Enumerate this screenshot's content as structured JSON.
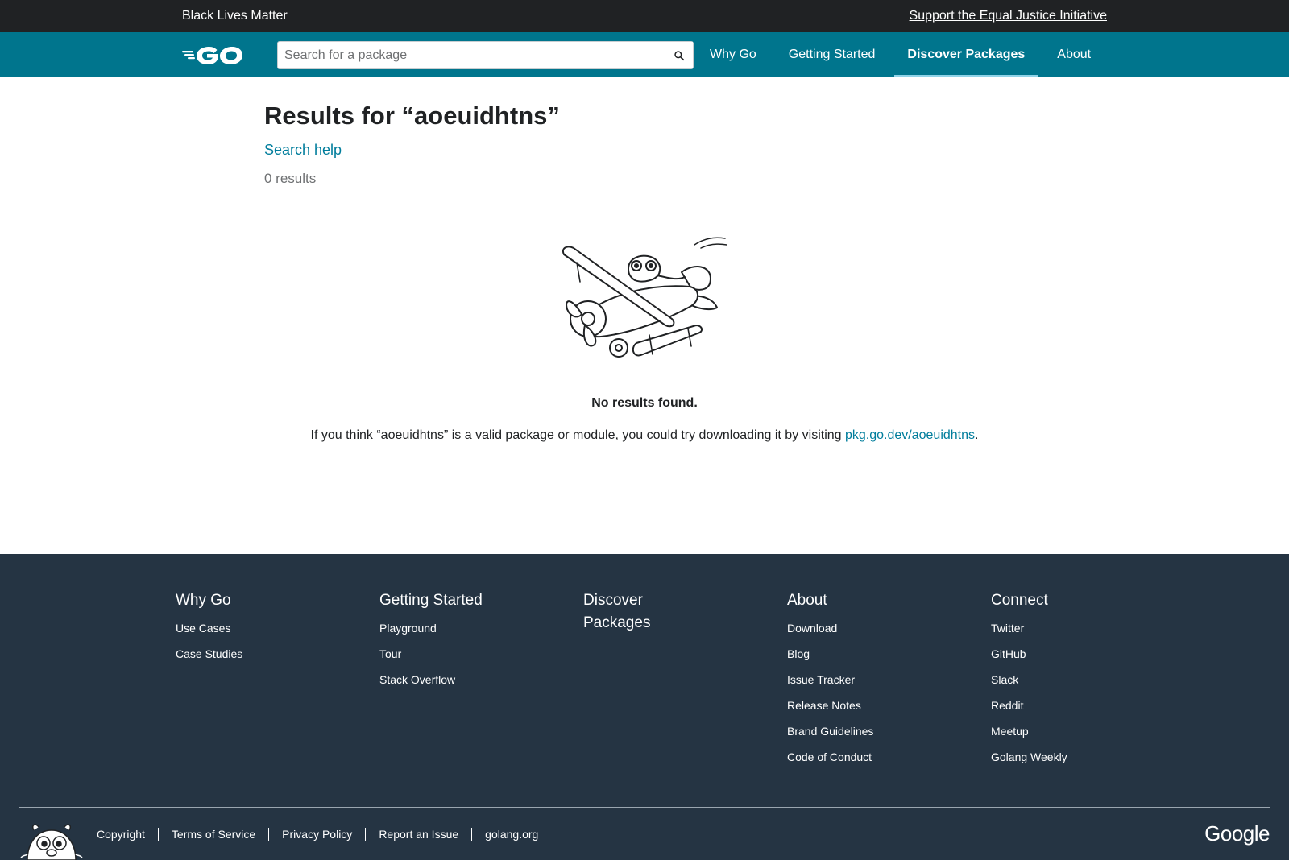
{
  "banner": {
    "blm_text": "Black Lives Matter",
    "eji_link": "Support the Equal Justice Initiative"
  },
  "header": {
    "logo_alt": "GO",
    "search": {
      "placeholder": "Search for a package",
      "value": ""
    },
    "nav": [
      {
        "label": "Why Go",
        "active": false
      },
      {
        "label": "Getting Started",
        "active": false
      },
      {
        "label": "Discover Packages",
        "active": true
      },
      {
        "label": "About",
        "active": false
      }
    ]
  },
  "main": {
    "title": "Results for “aoeuidhtns”",
    "search_help": "Search help",
    "results_count": "0 results",
    "no_results": "No results found.",
    "suggest_prefix": "If you think “aoeuidhtns” is a valid package or module, you could try downloading it by visiting ",
    "suggest_link": "pkg.go.dev/aoeuidhtns",
    "suggest_suffix": "."
  },
  "footer": {
    "columns": [
      {
        "heading": "Why Go",
        "links": [
          "Use Cases",
          "Case Studies"
        ]
      },
      {
        "heading": "Getting Started",
        "links": [
          "Playground",
          "Tour",
          "Stack Overflow"
        ]
      },
      {
        "heading": "Discover Packages",
        "links": []
      },
      {
        "heading": "About",
        "links": [
          "Download",
          "Blog",
          "Issue Tracker",
          "Release Notes",
          "Brand Guidelines",
          "Code of Conduct"
        ]
      },
      {
        "heading": "Connect",
        "links": [
          "Twitter",
          "GitHub",
          "Slack",
          "Reddit",
          "Meetup",
          "Golang Weekly"
        ]
      }
    ],
    "bottom_links": [
      "Copyright",
      "Terms of Service",
      "Privacy Policy",
      "Report an Issue",
      "golang.org"
    ],
    "google_logo": "Google"
  },
  "colors": {
    "banner_bg": "#202224",
    "header_bg": "#00758d",
    "link": "#007d9c",
    "footer_bg": "#253443",
    "active_underline": "#8fd3e8"
  }
}
